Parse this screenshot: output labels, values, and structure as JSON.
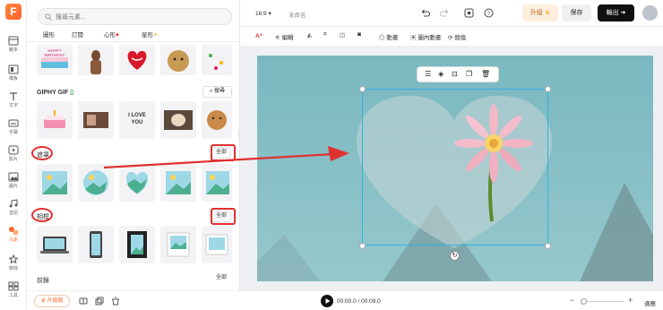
{
  "rail": {
    "logo": "F",
    "items": [
      "範本",
      "模板",
      "文字",
      "字幕",
      "影片",
      "圖片",
      "音訊",
      "元素",
      "特效",
      "工具"
    ]
  },
  "search": {
    "placeholder": "搜尋元素..."
  },
  "chips": [
    "圖形",
    "訂閱",
    "心形",
    "星形"
  ],
  "sections": {
    "giphy": "GIPHY GIF",
    "mask": "遮罩",
    "frame": "相框",
    "text": "前錄",
    "all": "全部",
    "search_btn": "搜尋"
  },
  "sticker_texts": {
    "happy": "HAPPY BIRTHDAY",
    "love": "I LOVE YOU"
  },
  "panel_bottom": {
    "upgrade": "升級版"
  },
  "topbar": {
    "ratio": "16:9",
    "title": "未命名",
    "upgrade": "升級",
    "save": "保存",
    "export": "輸出"
  },
  "toolbar": {
    "edit": "編輯",
    "animate": "動畫",
    "inner_animate": "圖內動畫",
    "replace": "替換"
  },
  "timeline": {
    "time": "00:00.0 / 00:09.0",
    "fit": "適應"
  },
  "colors": {
    "accent": "#ff6b2c",
    "annotation": "#e03131",
    "canvas": "#8ac1c7"
  }
}
